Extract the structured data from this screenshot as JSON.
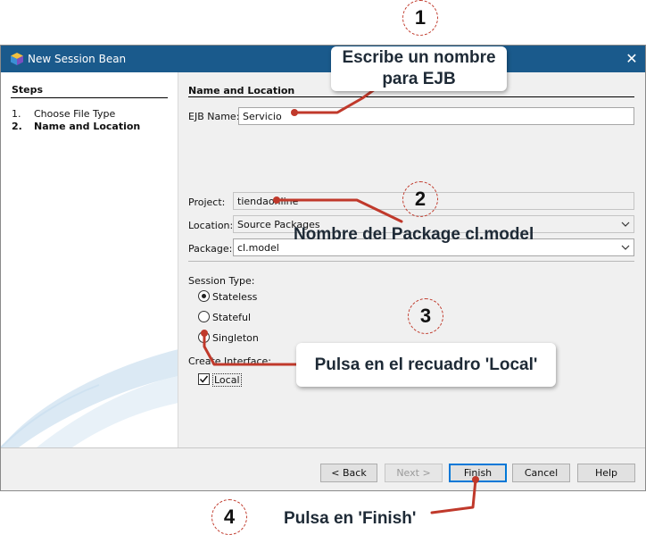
{
  "window": {
    "title": "New Session Bean",
    "close_glyph": "✕",
    "app_icon": "netbeans-cube-icon"
  },
  "steps": {
    "title": "Steps",
    "items": [
      {
        "num": "1.",
        "label": "Choose File Type",
        "active": false
      },
      {
        "num": "2.",
        "label": "Name and Location",
        "active": true
      }
    ]
  },
  "form": {
    "section_title": "Name and Location",
    "ejb_name_label": "EJB Name:",
    "ejb_name_value": "Servicio",
    "project_label": "Project:",
    "project_value": "tiendaonline",
    "location_label": "Location:",
    "location_value": "Source Packages",
    "package_label": "Package:",
    "package_value": "cl.model",
    "session_type_label": "Session Type:",
    "session_types": [
      {
        "label": "Stateless",
        "selected": true
      },
      {
        "label": "Stateful",
        "selected": false
      },
      {
        "label": "Singleton",
        "selected": false
      }
    ],
    "create_interface_label": "Create Interface:",
    "local_label": "Local",
    "local_checked": true
  },
  "buttons": {
    "back": "< Back",
    "next": "Next >",
    "finish": "Finish",
    "cancel": "Cancel",
    "help": "Help"
  },
  "annotations": {
    "step1_number": "1",
    "step1_text_line1": "Escribe un nombre",
    "step1_text_line2": "para EJB",
    "step2_number": "2",
    "step2_text": "Nombre del Package cl.model",
    "step3_number": "3",
    "step3_text": "Pulsa en el recuadro 'Local'",
    "step4_number": "4",
    "step4_text": "Pulsa en 'Finish'",
    "color": "#c0392b"
  }
}
